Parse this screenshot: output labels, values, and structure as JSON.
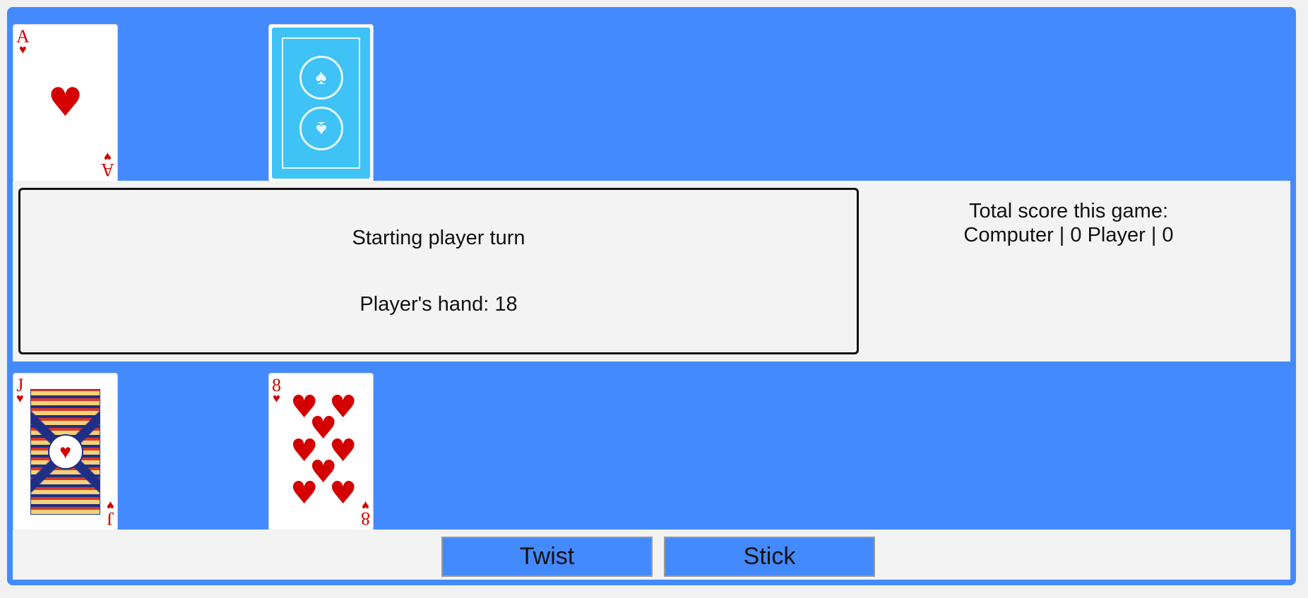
{
  "colors": {
    "table": "#448aff",
    "panel": "#f3f3f3",
    "suit_red": "#d40000",
    "card_back": "#3fc2f5"
  },
  "dealer": {
    "cards": [
      {
        "rank": "A",
        "suit": "♥",
        "face_up": true
      },
      {
        "face_up": false,
        "icon": "card-back-icon"
      }
    ]
  },
  "status": {
    "message": "Starting player turn",
    "hand_text": "Player's hand: 18"
  },
  "score": {
    "heading": "Total score this game:",
    "line": "Computer | 0 Player | 0"
  },
  "player": {
    "cards": [
      {
        "rank": "J",
        "suit": "♥",
        "face_up": true
      },
      {
        "rank": "8",
        "suit": "♥",
        "face_up": true
      }
    ]
  },
  "controls": {
    "twist_label": "Twist",
    "stick_label": "Stick"
  }
}
